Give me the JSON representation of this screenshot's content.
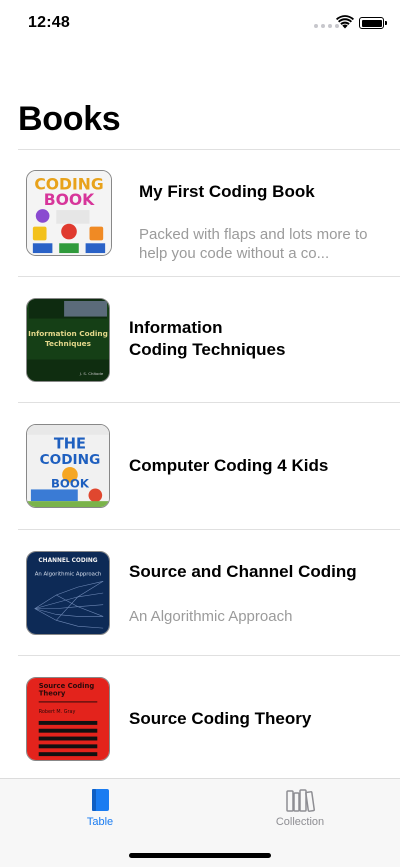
{
  "status_bar": {
    "time": "12:48"
  },
  "page_title": "Books",
  "books": [
    {
      "title": "My First Coding Book",
      "subtitle": "Packed with flaps and lots more to help you code without a co..."
    },
    {
      "title": "Information\nCoding Techniques",
      "subtitle": ""
    },
    {
      "title": "Computer Coding 4 Kids",
      "subtitle": ""
    },
    {
      "title": "Source and Channel Coding",
      "subtitle": "An Algorithmic Approach"
    },
    {
      "title": "Source Coding Theory",
      "subtitle": ""
    }
  ],
  "tab_bar": {
    "table_label": "Table",
    "collection_label": "Collection"
  },
  "colors": {
    "accent": "#1a7cf1",
    "inactive": "#8e8e93",
    "subtitle": "#9b9b9b"
  }
}
